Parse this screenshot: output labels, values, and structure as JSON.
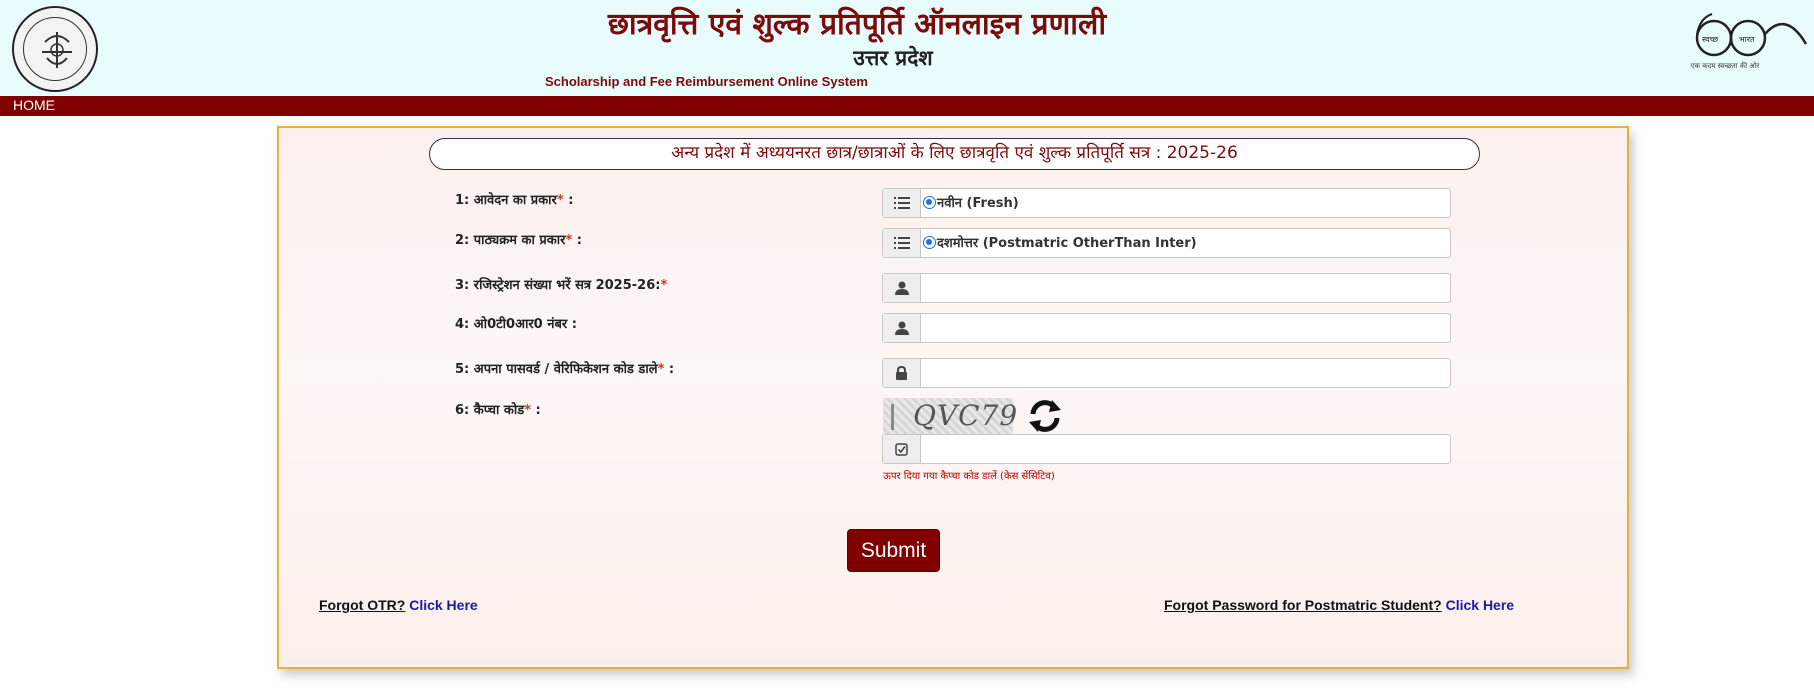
{
  "header": {
    "title_hi": "छात्रवृत्ति एवं शुल्क प्रतिपूर्ति ऑनलाइन प्रणाली",
    "subtitle_hi": "उत्तर प्रदेश",
    "subtitle_en": "Scholarship and Fee Reimbursement Online System",
    "emblem_icon": "up-govt-emblem-icon",
    "swachh_icon": "swachh-bharat-glasses-icon",
    "swachh_left": "स्वच्छ",
    "swachh_right": "भारत",
    "swachh_tagline": "एक कदम स्वच्छता की ओर"
  },
  "nav": {
    "home_label": "HOME"
  },
  "form": {
    "banner": "अन्य प्रदेश में अध्ययनरत छात्र/छात्राओं के लिए छात्रवृति एवं शुल्क प्रतिपूर्ति सत्र : 2025-26",
    "fields": [
      {
        "label": "1: आवेदन का प्रकार",
        "required": "*",
        "suffix": " :",
        "icon": "list-icon",
        "value": "नवीन (Fresh)"
      },
      {
        "label": "2: पाठ्यक्रम का प्रकार",
        "required": "*",
        "suffix": " :",
        "icon": "list-icon",
        "value": "दशमोत्तर (Postmatric OtherThan Inter)"
      },
      {
        "label": "3: रजिस्ट्रेशन संख्या भरें सत्र 2025-26:",
        "required": "*",
        "suffix": "",
        "icon": "user-icon",
        "value": ""
      },
      {
        "label": "4: ओ0टी0आर0 नंबर :",
        "required": "",
        "suffix": "",
        "icon": "user-icon",
        "value": ""
      },
      {
        "label": "5: अपना पासवर्ड / वेरिफिकेशन कोड डाले",
        "required": "*",
        "suffix": " :",
        "icon": "lock-icon",
        "value": ""
      },
      {
        "label": "6: कैप्चा कोड",
        "required": "*",
        "suffix": " :",
        "icon": "check-square-icon",
        "value": ""
      }
    ],
    "captcha_text": "QVC79",
    "captcha_hint": "ऊपर दिया गया कैप्चा कोड डालें (केस सेंसिटिव)",
    "submit_label": "Submit"
  },
  "links": {
    "forgot_otr_q": "Forgot OTR?",
    "forgot_otr_link": "Click Here",
    "forgot_pwd_q": "Forgot Password for Postmatric Student?",
    "forgot_pwd_link": "Click Here"
  },
  "colors": {
    "brand_maroon": "#800000",
    "panel_border": "#e2b23c",
    "header_bg": "#e8fbfd",
    "link_blue": "#1a1aa8"
  }
}
